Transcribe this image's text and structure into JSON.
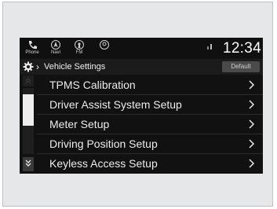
{
  "status_bar": {
    "items": [
      {
        "label": "Phone",
        "icon": "phone-icon"
      },
      {
        "label": "Navi",
        "icon": "navigation-icon"
      },
      {
        "label": "FM",
        "icon": "radio-icon"
      },
      {
        "label": "",
        "icon": "audio-source-icon"
      }
    ],
    "clock": "12:34",
    "signal_icon": "signal-strength-icon"
  },
  "header": {
    "settings_icon": "gear-icon",
    "title": "Vehicle Settings",
    "default_label": "Default"
  },
  "menu": {
    "items": [
      {
        "label": "TPMS Calibration"
      },
      {
        "label": "Driver Assist System Setup"
      },
      {
        "label": "Meter Setup"
      },
      {
        "label": "Driving Position Setup"
      },
      {
        "label": "Keyless Access Setup"
      }
    ]
  },
  "colors": {
    "screen_bg": "#111111",
    "text": "#ececec",
    "button_bg": "#4a4a4a",
    "bezel": "#e6e7e8"
  }
}
